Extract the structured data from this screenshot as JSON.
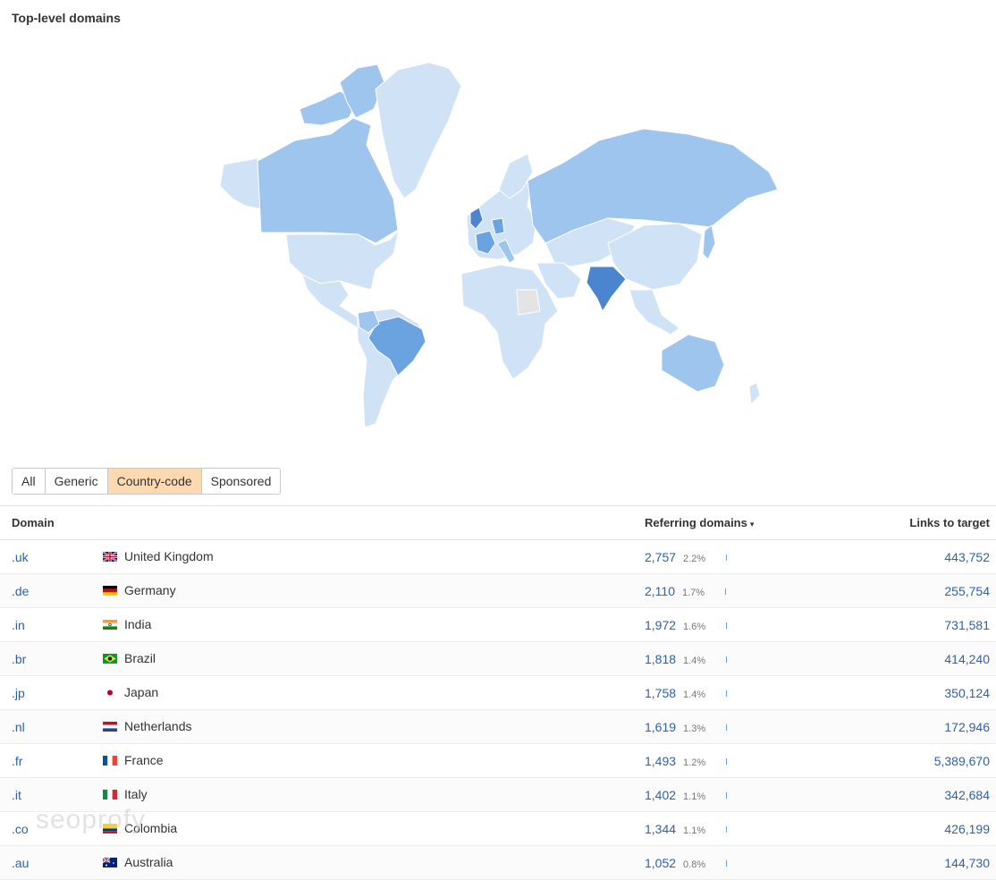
{
  "title": "Top-level domains",
  "watermark": "seoprofy",
  "filters": [
    {
      "label": "All",
      "active": false
    },
    {
      "label": "Generic",
      "active": false
    },
    {
      "label": "Country-code",
      "active": true
    },
    {
      "label": "Sponsored",
      "active": false
    }
  ],
  "table": {
    "headers": {
      "domain": "Domain",
      "referring_domains": "Referring domains",
      "sort_indicator": "▾",
      "links_to_target": "Links to target"
    },
    "rows": [
      {
        "tld": ".uk",
        "country": "United Kingdom",
        "flag": "flag-uk-icon",
        "referring": "2,757",
        "pct": "2.2%",
        "links": "443,752"
      },
      {
        "tld": ".de",
        "country": "Germany",
        "flag": "flag-de-icon",
        "referring": "2,110",
        "pct": "1.7%",
        "links": "255,754"
      },
      {
        "tld": ".in",
        "country": "India",
        "flag": "flag-in-icon",
        "referring": "1,972",
        "pct": "1.6%",
        "links": "731,581"
      },
      {
        "tld": ".br",
        "country": "Brazil",
        "flag": "flag-br-icon",
        "referring": "1,818",
        "pct": "1.4%",
        "links": "414,240"
      },
      {
        "tld": ".jp",
        "country": "Japan",
        "flag": "flag-jp-icon",
        "referring": "1,758",
        "pct": "1.4%",
        "links": "350,124"
      },
      {
        "tld": ".nl",
        "country": "Netherlands",
        "flag": "flag-nl-icon",
        "referring": "1,619",
        "pct": "1.3%",
        "links": "172,946"
      },
      {
        "tld": ".fr",
        "country": "France",
        "flag": "flag-fr-icon",
        "referring": "1,493",
        "pct": "1.2%",
        "links": "5,389,670"
      },
      {
        "tld": ".it",
        "country": "Italy",
        "flag": "flag-it-icon",
        "referring": "1,402",
        "pct": "1.1%",
        "links": "342,684"
      },
      {
        "tld": ".co",
        "country": "Colombia",
        "flag": "flag-co-icon",
        "referring": "1,344",
        "pct": "1.1%",
        "links": "426,199"
      },
      {
        "tld": ".au",
        "country": "Australia",
        "flag": "flag-au-icon",
        "referring": "1,052",
        "pct": "0.8%",
        "links": "144,730"
      }
    ]
  },
  "map": {
    "icon": "world-choropleth-map",
    "colors": {
      "high": "#6aa3e0",
      "mid": "#9ec5ee",
      "low": "#cfe2f6",
      "none": "#e4e4e4"
    }
  }
}
